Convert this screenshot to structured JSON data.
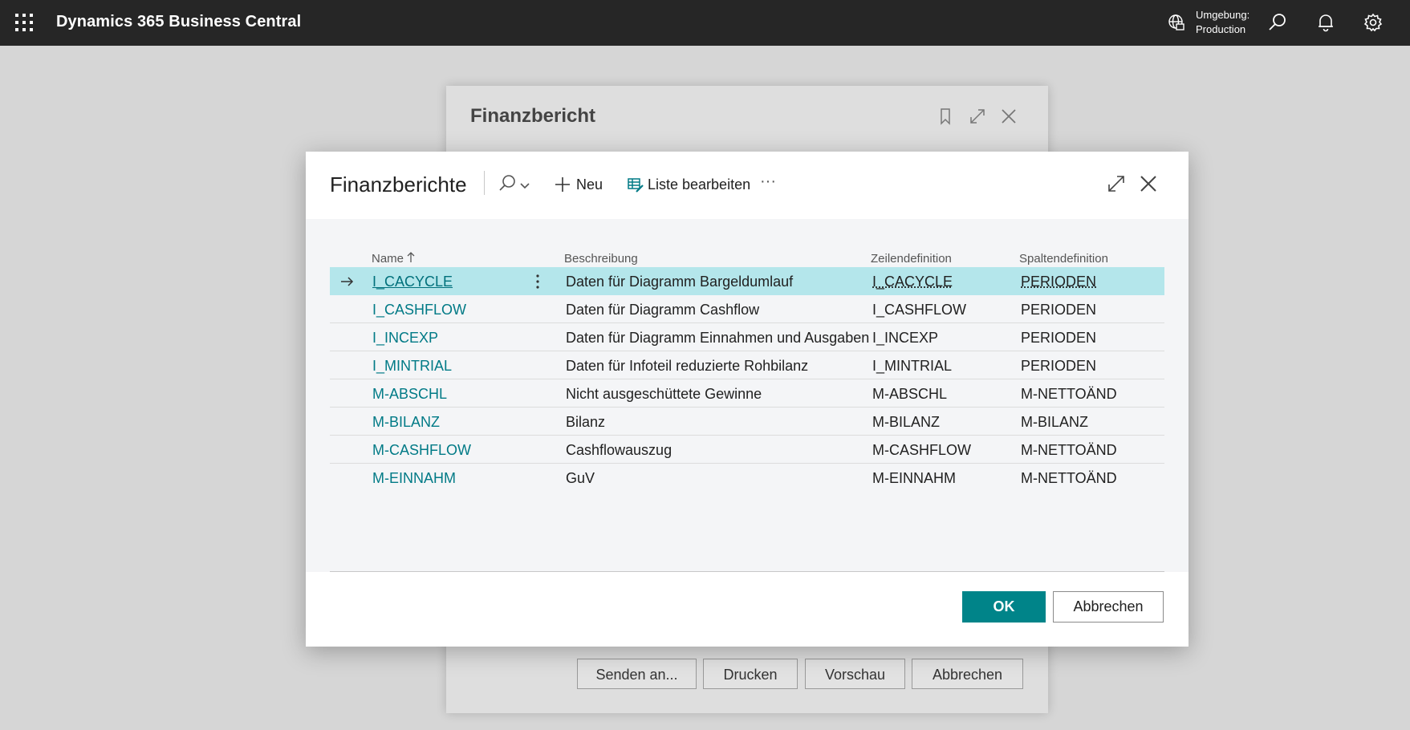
{
  "topbar": {
    "app_title": "Dynamics 365 Business Central",
    "environment_label": "Umgebung:",
    "environment_value": "Production"
  },
  "background_dialog": {
    "title": "Finanzbericht",
    "buttons": [
      "Senden an...",
      "Drucken",
      "Vorschau",
      "Abbrechen"
    ]
  },
  "dialog": {
    "title": "Finanzberichte",
    "new_label": "Neu",
    "edit_list_label": "Liste bearbeiten",
    "more_label": "···",
    "columns": {
      "name": "Name",
      "description": "Beschreibung",
      "row_definition": "Zeilendefinition",
      "column_definition": "Spaltendefinition"
    },
    "rows": [
      {
        "name": "I_CACYCLE",
        "description": "Daten für Diagramm Bargeldumlauf",
        "row_def": "I_CACYCLE",
        "col_def": "PERIODEN",
        "selected": true
      },
      {
        "name": "I_CASHFLOW",
        "description": "Daten für Diagramm Cashflow",
        "row_def": "I_CASHFLOW",
        "col_def": "PERIODEN"
      },
      {
        "name": "I_INCEXP",
        "description": "Daten für Diagramm Einnahmen und Ausgaben",
        "row_def": "I_INCEXP",
        "col_def": "PERIODEN"
      },
      {
        "name": "I_MINTRIAL",
        "description": "Daten für Infoteil reduzierte Rohbilanz",
        "row_def": "I_MINTRIAL",
        "col_def": "PERIODEN"
      },
      {
        "name": "M-ABSCHL",
        "description": "Nicht ausgeschüttete Gewinne",
        "row_def": "M-ABSCHL",
        "col_def": "M-NETTOÄND"
      },
      {
        "name": "M-BILANZ",
        "description": "Bilanz",
        "row_def": "M-BILANZ",
        "col_def": "M-BILANZ"
      },
      {
        "name": "M-CASHFLOW",
        "description": "Cashflowauszug",
        "row_def": "M-CASHFLOW",
        "col_def": "M-NETTOÄND"
      },
      {
        "name": "M-EINNAHM",
        "description": "GuV",
        "row_def": "M-EINNAHM",
        "col_def": "M-NETTOÄND"
      }
    ],
    "ok_label": "OK",
    "cancel_label": "Abbrechen"
  },
  "colors": {
    "accent": "#008489",
    "link": "#007a86",
    "selected_row": "#b4e6eb",
    "topbar": "#262626"
  }
}
